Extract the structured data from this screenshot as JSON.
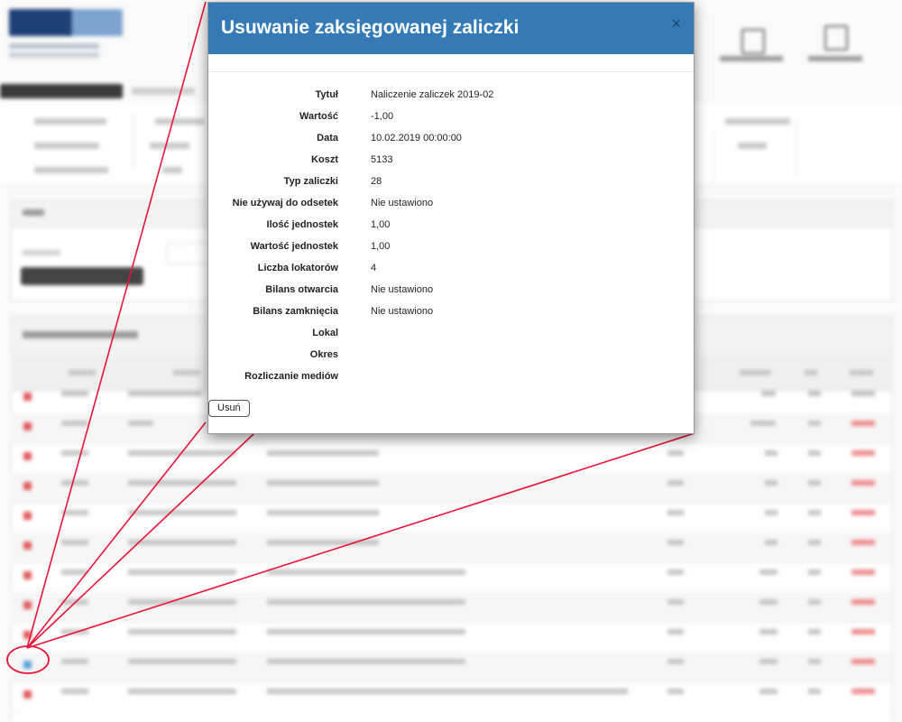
{
  "modal": {
    "title": "Usuwanie zaksięgowanej zaliczki",
    "close_glyph": "×",
    "fields": [
      {
        "label": "Tytuł",
        "value": "Naliczenie zaliczek 2019-02"
      },
      {
        "label": "Wartość",
        "value": "-1,00"
      },
      {
        "label": "Data",
        "value": "10.02.2019 00:00:00"
      },
      {
        "label": "Koszt",
        "value": "5133"
      },
      {
        "label": "Typ zaliczki",
        "value": "28"
      },
      {
        "label": "Nie używaj do odsetek",
        "value": "Nie ustawiono"
      },
      {
        "label": "Ilość jednostek",
        "value": "1,00"
      },
      {
        "label": "Wartość jednostek",
        "value": "1,00"
      },
      {
        "label": "Liczba lokatorów",
        "value": "4"
      },
      {
        "label": "Bilans otwarcia",
        "value": "Nie ustawiono"
      },
      {
        "label": "Bilans zamknięcia",
        "value": "Nie ustawiono"
      },
      {
        "label": "Lokal",
        "value": ""
      },
      {
        "label": "Okres",
        "value": ""
      },
      {
        "label": "Rozliczanie mediów",
        "value": ""
      }
    ],
    "delete_label": "Usuń"
  },
  "colors": {
    "header": "#337ab7",
    "annotation": "#e8143c"
  }
}
